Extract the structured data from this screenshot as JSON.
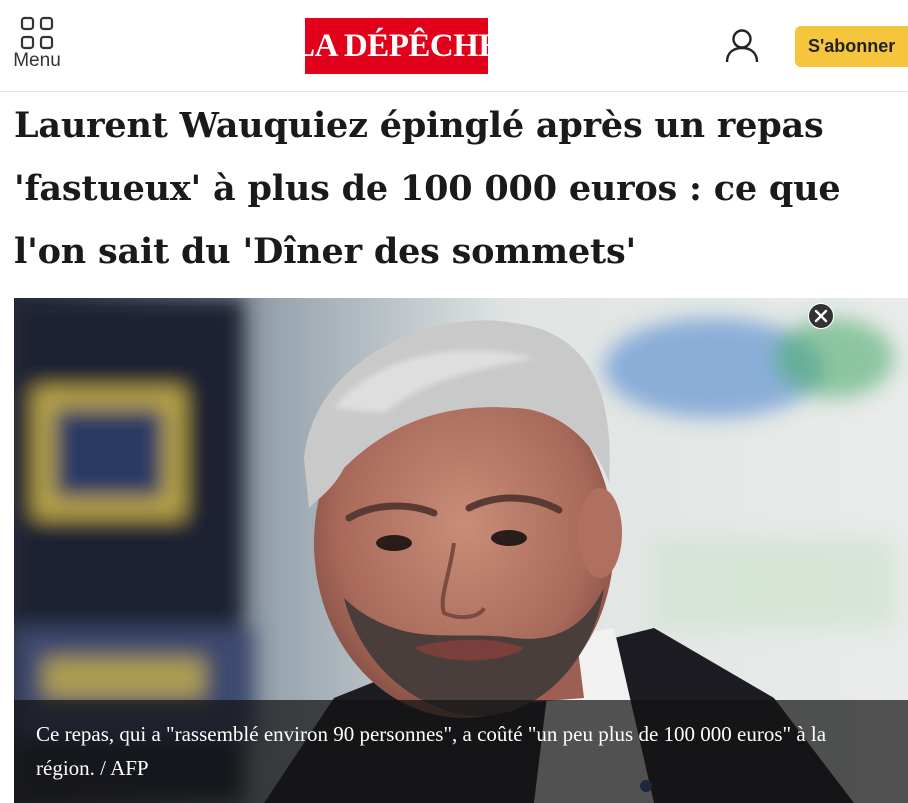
{
  "header": {
    "menu_label": "Menu",
    "menu_icon": "grid-icon",
    "logo_text": "LA DÉPÊCHE",
    "logo_color": "#e2001a",
    "account_icon": "user-icon",
    "subscribe_label": "S'abonner",
    "subscribe_color": "#f5c53d"
  },
  "article": {
    "headline": "Laurent Wauquiez épinglé après un repas 'fastueux' à plus de 100 000 euros : ce que l'on sait du 'Dîner des sommets'"
  },
  "photo": {
    "close_icon": "close-icon",
    "caption": "Ce repas, qui a \"rassemblé environ 90 personnes\", a coûté \"un peu plus de 100 000 euros\" à la région.",
    "credit": " / AFP"
  }
}
